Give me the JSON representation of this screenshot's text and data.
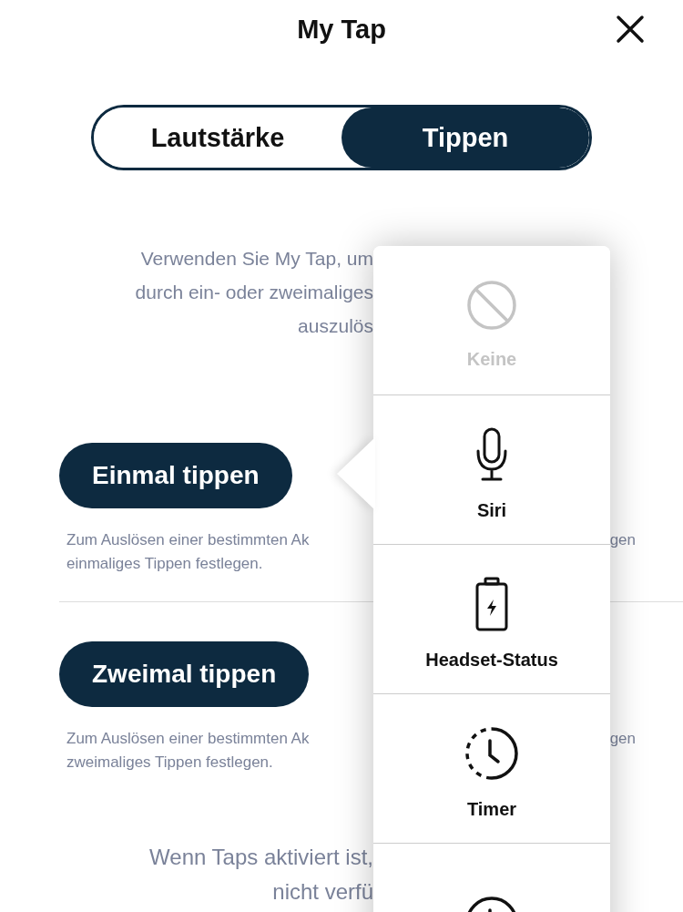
{
  "header": {
    "title": "My Tap"
  },
  "tabs": [
    {
      "label": "Lautstärke",
      "selected": false
    },
    {
      "label": "Tippen",
      "selected": true
    }
  ],
  "intro": [
    "Verwenden Sie My Tap, um",
    "durch ein- oder zweimaliges",
    "auszulös"
  ],
  "sections": [
    {
      "label": "Einmal tippen",
      "lines": [
        "Zum Auslösen einer bestimmten Ak",
        "einmaliges Tippen festlegen."
      ],
      "trailing": "gen"
    },
    {
      "label": "Zweimal tippen",
      "lines": [
        "Zum Auslösen einer bestimmten Ak",
        "zweimaliges Tippen festlegen."
      ],
      "trailing": "gen"
    }
  ],
  "footer": [
    "Wenn Taps aktiviert ist,",
    "nicht verfü"
  ],
  "menu": [
    {
      "kind": "none",
      "label": "Keine",
      "disabled": true
    },
    {
      "kind": "mic",
      "label": "Siri",
      "disabled": false
    },
    {
      "kind": "battery",
      "label": "Headset-Status",
      "disabled": false
    },
    {
      "kind": "timer",
      "label": "Timer",
      "disabled": false
    },
    {
      "kind": "clock",
      "disabled": false
    }
  ]
}
